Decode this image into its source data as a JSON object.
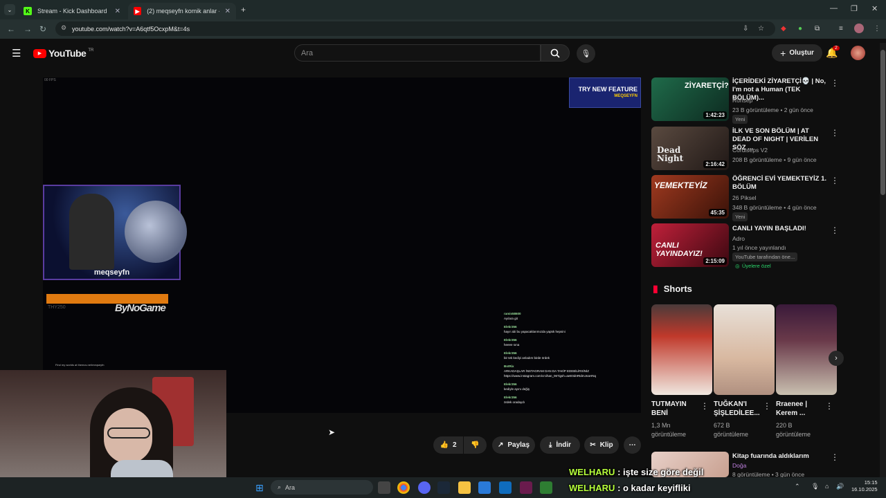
{
  "browser": {
    "tabs": [
      {
        "title": "Stream - Kick Dashboard",
        "icon": "kick-icon"
      },
      {
        "title": "(2) meqseyfn komik anlar - You",
        "icon": "youtube-icon"
      }
    ],
    "url": "youtube.com/watch?v=A6qtf5OcxpM&t=4s"
  },
  "youtube": {
    "logo_text": "YouTube",
    "region": "TR",
    "search_placeholder": "Ara",
    "create_label": "Oluştur",
    "notifications_count": "2"
  },
  "video": {
    "fps_text": "00 FPS",
    "try_feature_text": "TRY NEW FEATURE",
    "try_feature_sub": "MEQSEYFN",
    "cam_name": "meqseyfn",
    "brand_text": "ByNoGame",
    "tiny_text": "THY250",
    "findme_text": "Find my worlds at themcs.net/meqseyfn",
    "chat": [
      {
        "user": "ramis58600",
        "msg": "Ayılara git"
      },
      {
        "user": "Elekr356",
        "msg": "hayır abi bu yapacaklarımızda yaptık hepsini"
      },
      {
        "user": "Elekr356",
        "msg": "heeee sına"
      },
      {
        "user": "Elekr356",
        "msg": "bir tek kediyi anladım birde ördek"
      },
      {
        "user": "BotRix",
        "msg": "ARKADAŞLAR İNSTAGRAM DAN DA TAKİP EDEBİLİRSİNİZ https://www.instagram.com/crcihan_06?igsh=aeE0dnRtdmJnaHNq"
      },
      {
        "user": "Elekr356",
        "msg": "kediyle ayını değiş"
      },
      {
        "user": "Elekr356",
        "msg": "ördek oradaydı"
      }
    ]
  },
  "actions": {
    "like_count": "2",
    "share_label": "Paylaş",
    "download_label": "İndir",
    "clip_label": "Klip"
  },
  "recommendations": [
    {
      "title": "İÇERİDEKİ ZİYARETÇİ💀 | No, I'm not a Human (TEK BÖLÜM)...",
      "channel": "Ronsep",
      "meta": "23 B görüntüleme • 2 gün önce",
      "badge": "Yeni",
      "duration": "1:42:23",
      "thumb_color": "#1f6b4a",
      "thumb_text": "ZİYARETÇİ?"
    },
    {
      "title": "İLK VE SON BÖLÜM | AT DEAD OF NIGHT | VERİLEN SÖZ ...",
      "channel": "Cordiseps V2",
      "meta": "208 B görüntüleme • 9 gün önce",
      "badge": "",
      "duration": "2:16:42",
      "thumb_color": "#3a2e2a",
      "thumb_text": "Dead Night"
    },
    {
      "title": "ÖĞRENCİ EVİ YEMEKTEYİZ 1. BÖLÜM",
      "channel": "26 Piksel",
      "meta": "348 B görüntüleme • 4 gün önce",
      "badge": "Yeni",
      "duration": "45:35",
      "thumb_color": "#7a2a1a",
      "thumb_text": "YEMEKTEYİZ"
    },
    {
      "title": "CANLI YAYIN BAŞLADI!",
      "channel": "Adro",
      "meta": "1 yıl önce yayınlandı",
      "badge": "YouTube tarafından öne...",
      "badge2": "Üyelere özel",
      "duration": "2:15:09",
      "thumb_color": "#8a1020",
      "thumb_text": "CANLI YAYINDAYIZ!"
    }
  ],
  "shorts": {
    "heading": "Shorts",
    "items": [
      {
        "title": "TUTMAYIN BENİ",
        "views": "1,3 Mn görüntüleme",
        "color": "#c0392b"
      },
      {
        "title": "TUĞKAN'I ŞİŞLEDİLEE...",
        "views": "672 B görüntüleme",
        "color": "#d8c8b8"
      },
      {
        "title": "Rraenee | Kerem ...",
        "views": "220 B görüntüleme",
        "color": "#5a2a4a"
      }
    ]
  },
  "next_rec": {
    "title": "Kitap fuarında aldıklarım",
    "channel": "Doğa",
    "meta": "8 görüntüleme • 3 gün önce"
  },
  "overlay_chat": [
    {
      "name": "WELHARU",
      "msg": ": işte size göre değil"
    },
    {
      "name": "WELHARU",
      "msg": ": o kadar keyifliki"
    }
  ],
  "taskbar": {
    "search_label": "Ara",
    "time": "15:15",
    "date": "16.10.2025"
  }
}
